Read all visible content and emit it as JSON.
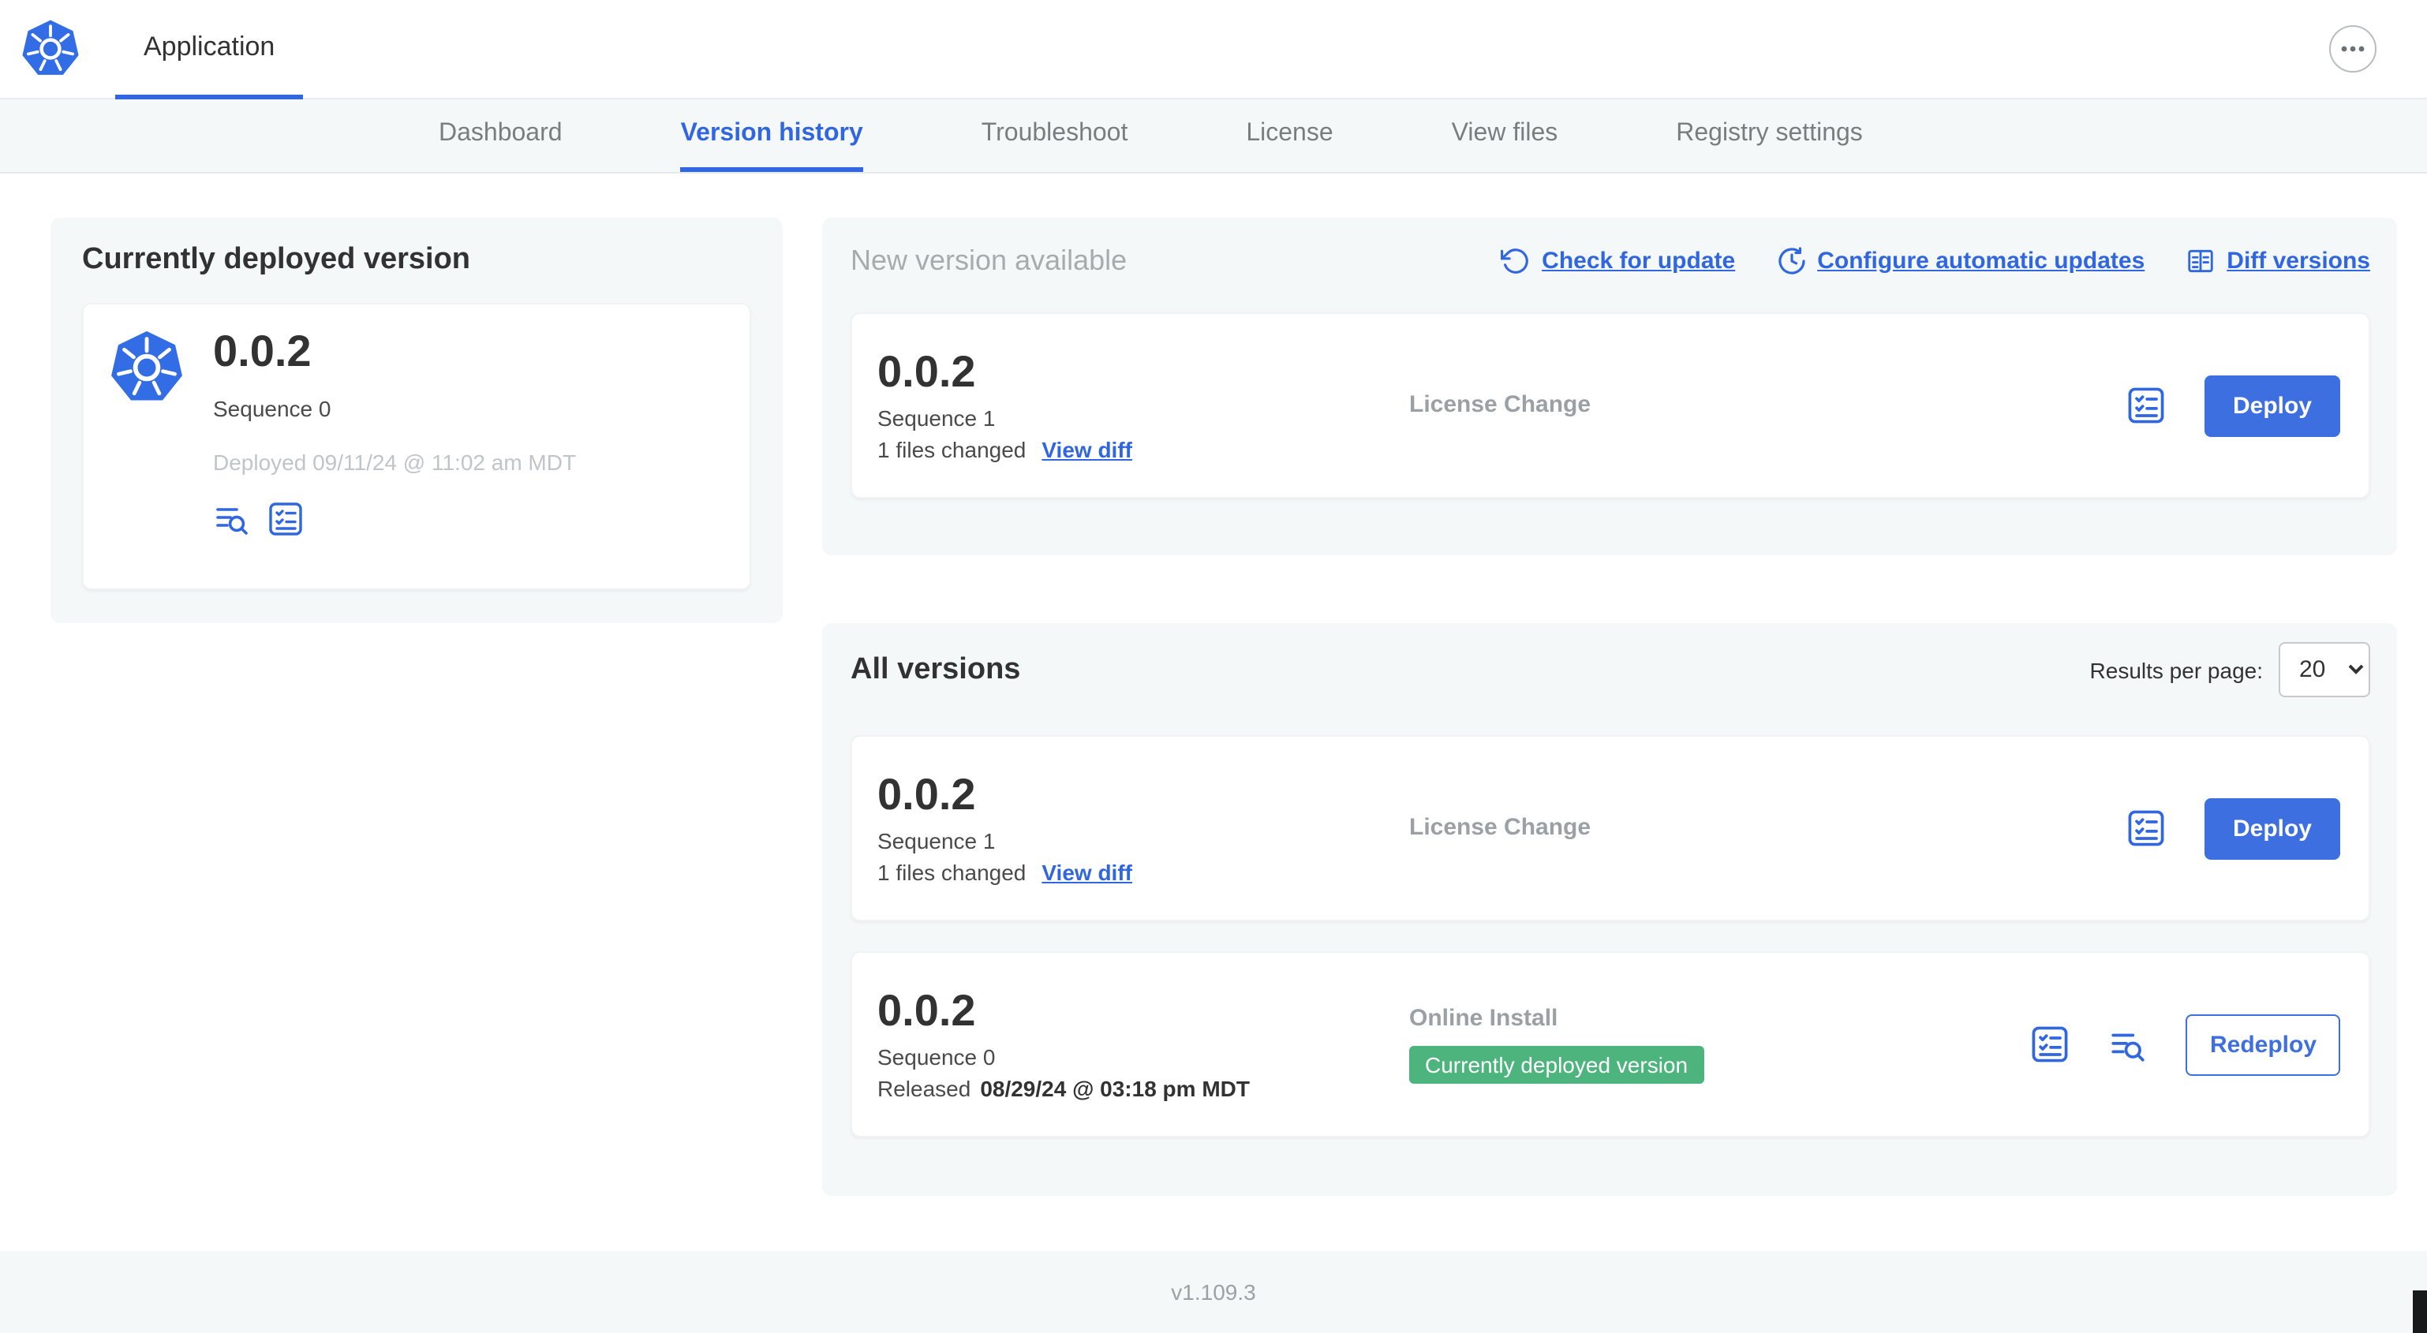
{
  "header": {
    "app_tab": "Application"
  },
  "nav": {
    "tabs": [
      {
        "label": "Dashboard",
        "active": false
      },
      {
        "label": "Version history",
        "active": true
      },
      {
        "label": "Troubleshoot",
        "active": false
      },
      {
        "label": "License",
        "active": false
      },
      {
        "label": "View files",
        "active": false
      },
      {
        "label": "Registry settings",
        "active": false
      }
    ]
  },
  "deployed": {
    "title": "Currently deployed version",
    "version": "0.0.2",
    "sequence": "Sequence 0",
    "deployed_at": "Deployed 09/11/24 @ 11:02 am MDT"
  },
  "new_version": {
    "title": "New version available",
    "check_for_update": "Check for update",
    "configure_updates": "Configure automatic updates",
    "diff_versions": "Diff versions",
    "row": {
      "version": "0.0.2",
      "sequence": "Sequence 1",
      "files_changed": "1 files changed",
      "view_diff": "View diff",
      "change_type": "License Change",
      "deploy": "Deploy"
    }
  },
  "all_versions": {
    "title": "All versions",
    "results_per_page_label": "Results per page:",
    "results_per_page": "20",
    "rows": [
      {
        "version": "0.0.2",
        "sequence": "Sequence 1",
        "files_changed": "1 files changed",
        "view_diff": "View diff",
        "change_type": "License Change",
        "action": "Deploy"
      },
      {
        "version": "0.0.2",
        "sequence": "Sequence 0",
        "released_label": "Released",
        "released_date": "08/29/24 @ 03:18 pm MDT",
        "change_type": "Online Install",
        "badge": "Currently deployed version",
        "action": "Redeploy"
      }
    ]
  },
  "footer": {
    "version": "v1.109.3"
  },
  "icons": {
    "kubernetes-logo": "k8s-heptagon-wheel",
    "overflow-menu-icon": "ellipsis",
    "check-update-icon": "rotate-ccw",
    "auto-updates-icon": "clock",
    "diff-versions-icon": "columns-table",
    "release-notes-icon": "checklist",
    "view-logs-icon": "lines-magnifier",
    "select-chevron": "chevron-down"
  },
  "colors": {
    "accent_blue": "#3066e0",
    "k8s_blue": "#326de6",
    "badge_green": "#4eb47e",
    "panel_gray": "#f5f8f9",
    "muted_text": "#9aa0a4"
  }
}
